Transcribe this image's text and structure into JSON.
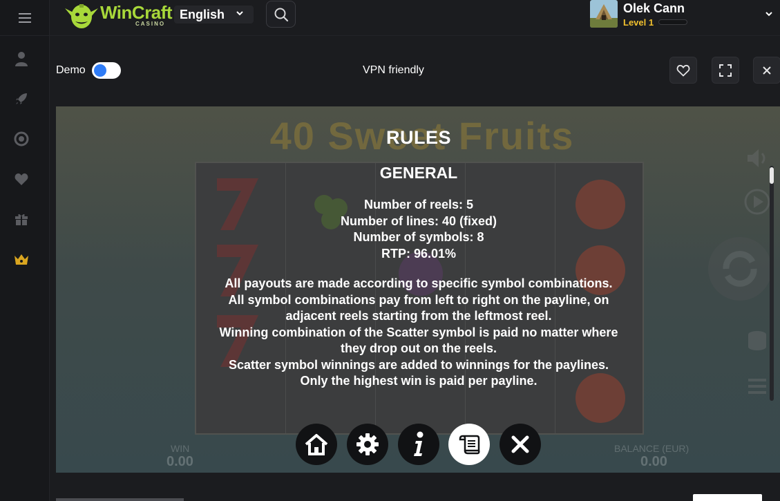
{
  "header": {
    "logo_text": "WinCraft",
    "logo_sub": "CASINO",
    "language": "English",
    "user_name": "Olek Cann",
    "user_level": "Level 1",
    "level_progress": 0.0
  },
  "sidebar": {
    "items": [
      {
        "icon": "user-icon"
      },
      {
        "icon": "rocket-icon"
      },
      {
        "icon": "lifebuoy-icon"
      },
      {
        "icon": "heart-icon"
      },
      {
        "icon": "gift-icon"
      },
      {
        "icon": "crown-icon",
        "color": "#d9a520"
      }
    ]
  },
  "toolbar": {
    "demo_label": "Demo",
    "demo_on": true,
    "vpn_label": "VPN friendly"
  },
  "game": {
    "title_bg": "40 Sweet Fruits",
    "win_label": "WIN",
    "win_value": "0.00",
    "balance_label": "BALANCE (EUR)",
    "balance_value": "0.00"
  },
  "rules": {
    "title": "RULES",
    "section": "GENERAL",
    "stats": [
      "Number of reels: 5",
      "Number of lines: 40 (fixed)",
      "Number of symbols: 8",
      "RTP: 96.01%"
    ],
    "paragraphs": [
      "All payouts are made according to specific symbol combinations.",
      "All symbol combinations pay from left to right on the payline, on adjacent reels starting from the leftmost reel.",
      "Winning combination of the Scatter symbol is paid no matter where they drop out on the reels.",
      "Scatter symbol winnings are added to winnings for the paylines.",
      "Only the highest win is paid per payline."
    ]
  },
  "colors": {
    "accent_blue": "#2f7cf6",
    "level_yellow": "#f2c12e",
    "logo_green": "#a8d83a"
  }
}
